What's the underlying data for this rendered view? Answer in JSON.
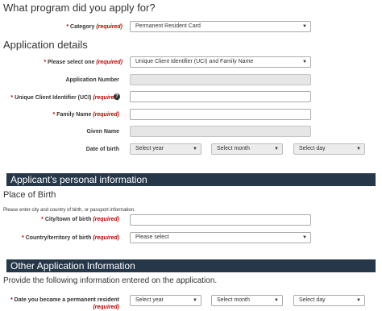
{
  "question": "What program did you apply for?",
  "category": {
    "label": "Category",
    "required": "(required)",
    "value": "Permanent Resident Card"
  },
  "application_details": {
    "heading": "Application details",
    "select_one": {
      "label": "Please select one",
      "required": "(required)",
      "value": "Unique Client Identifier (UCI) and Family Name"
    },
    "application_number": {
      "label": "Application Number"
    },
    "uci": {
      "label": "Unique Client Identifier (UCI)",
      "required": "(required)",
      "help": "?"
    },
    "family_name": {
      "label": "Family Name",
      "required": "(required)"
    },
    "given_name": {
      "label": "Given Name"
    },
    "dob": {
      "label": "Date of birth",
      "year": "Select year",
      "month": "Select month",
      "day": "Select day"
    }
  },
  "personal": {
    "band": "Applicant's personal information",
    "place_heading": "Place of Birth",
    "instruction": "Please enter city and country of birth, or passport information.",
    "city": {
      "label": "City/town of birth",
      "required": "(required)"
    },
    "country": {
      "label": "Country/territory of birth",
      "required": "(required)",
      "value": "Please select"
    }
  },
  "other": {
    "band": "Other Application Information",
    "intro": "Provide the following information entered on the application.",
    "date_pr": {
      "label": "Date you became a permanent resident",
      "required": "(required)",
      "year": "Select year",
      "month": "Select month",
      "day": "Select day"
    }
  },
  "colors": {
    "band": "#26374a",
    "required": "#bb0000"
  }
}
